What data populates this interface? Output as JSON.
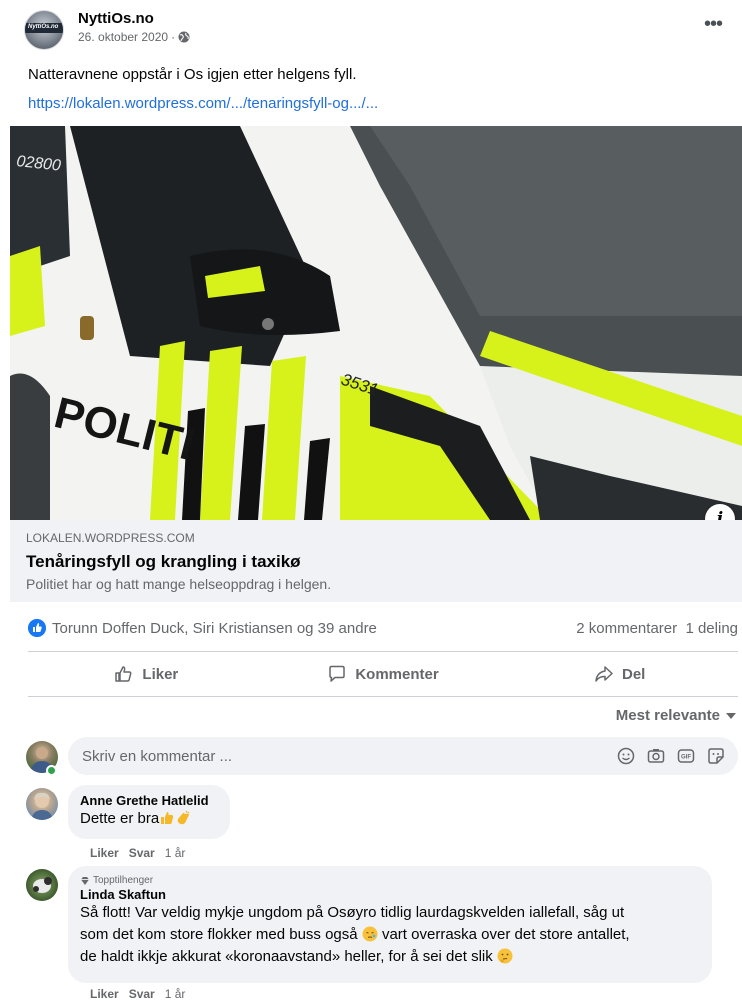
{
  "post": {
    "page_name": "NyttiOs.no",
    "avatar_text": "NyttiOs.no",
    "date": "26. oktober 2020",
    "meta_separator": "·",
    "privacy_icon": "globe-icon",
    "more_icon": "more-horizontal-icon",
    "more_label": "•••",
    "text": "Natteravnene oppstår i Os igjen etter helgens fyll.",
    "link_text": "https://lokalen.wordpress.com/.../tenaringsfyll-og.../..."
  },
  "link_preview": {
    "image_text": {
      "brand": "POLITI",
      "number": "3531",
      "plate": "02800"
    },
    "info_icon": "info-icon",
    "info_label": "i",
    "domain": "LOKALEN.WORDPRESS.COM",
    "title": "Tenåringsfyll og krangling i taxikø",
    "description": "Politiet har og hatt mange helseoppdrag i helgen."
  },
  "reactions": {
    "icon": "like-reaction-icon",
    "names": "Torunn Doffen Duck, Siri Kristiansen og 39 andre",
    "counts": "2 kommentarer  1 deling"
  },
  "actions": {
    "like": "Liker",
    "comment": "Kommenter",
    "share": "Del"
  },
  "sort": {
    "label": "Mest relevante"
  },
  "comment_input": {
    "placeholder": "Skriv en kommentar ...",
    "icons": [
      "emoji-icon",
      "camera-icon",
      "gif-icon",
      "sticker-icon"
    ]
  },
  "comments": [
    {
      "author": "Anne Grethe Hatlelid",
      "text": "Dette er bra",
      "like": "Liker",
      "reply": "Svar",
      "time": "1 år"
    },
    {
      "badge": "Topptilhenger",
      "author": "Linda Skaftun",
      "lines": [
        "Så flott! Var veldig mykje ungdom på Osøyro tidlig laurdagskvelden iallefall, såg ut",
        "som det kom store flokker med buss også",
        "vart overraska over det store antallet,",
        "de haldt ikkje akkurat «koronaavstand» heller, for å sei det slik"
      ],
      "like": "Liker",
      "reply": "Svar",
      "time": "1 år"
    }
  ],
  "colors": {
    "link": "#216fdb",
    "like_blue": "#1877f2",
    "online": "#31a24c",
    "police_yellow": "#d6f21a"
  }
}
